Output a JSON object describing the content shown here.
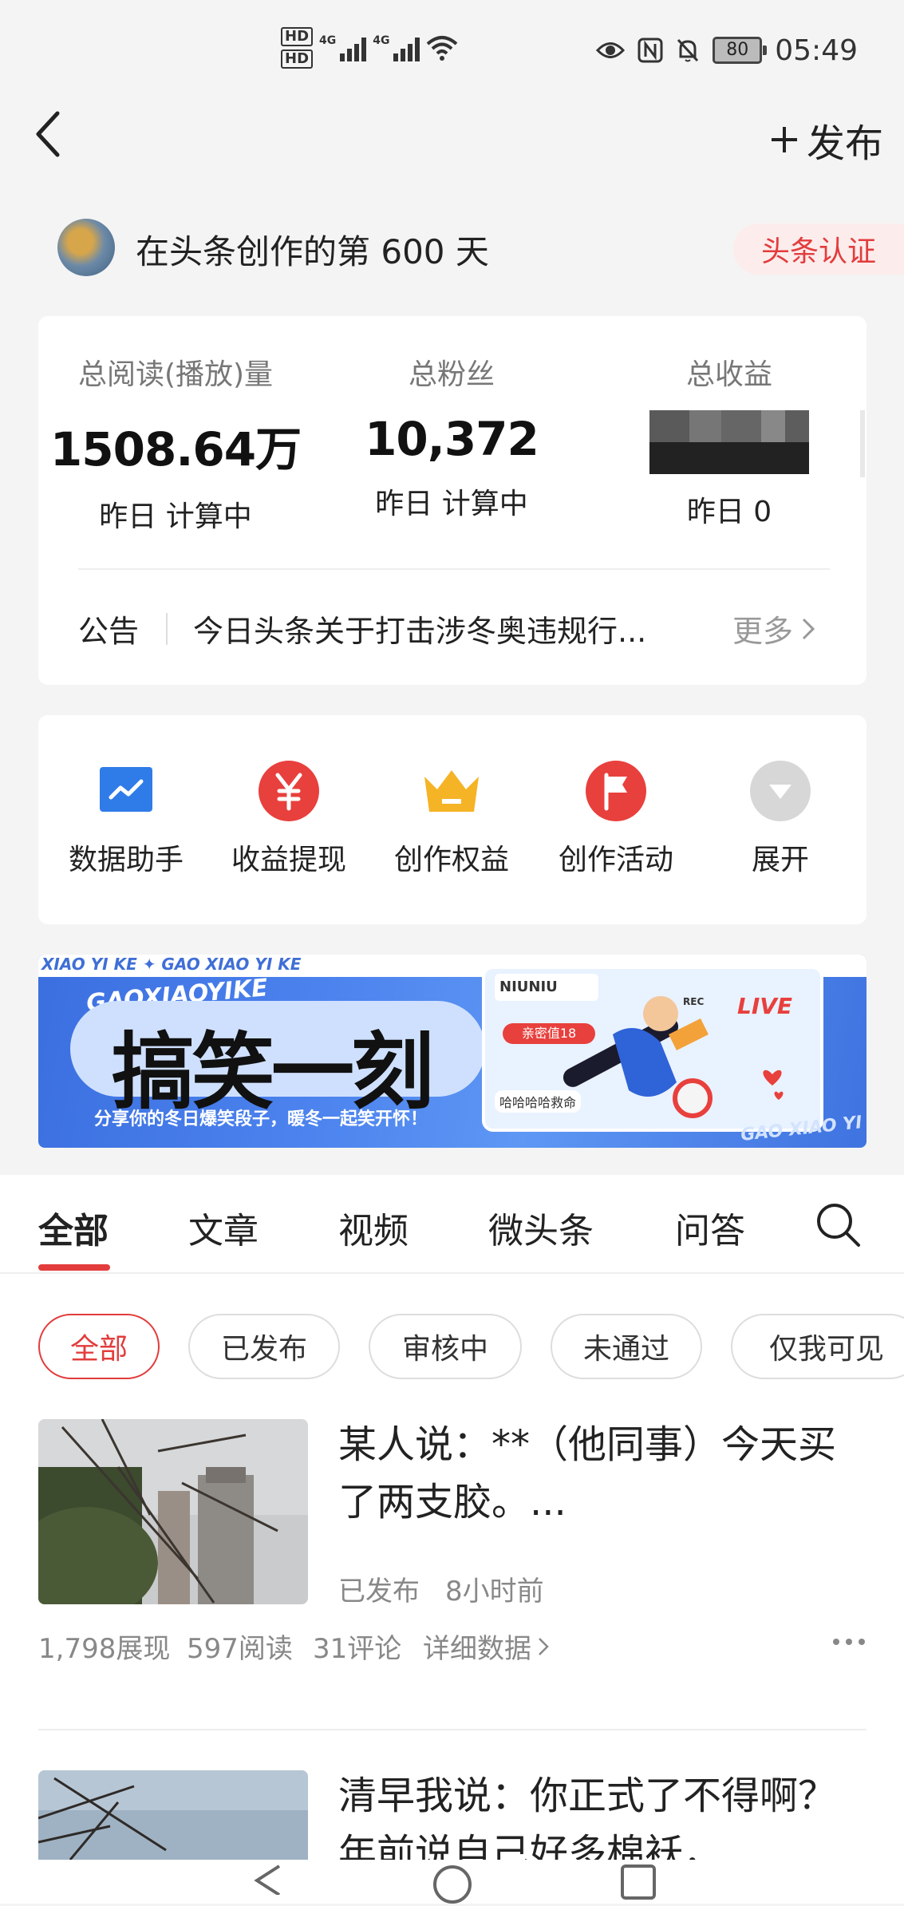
{
  "status_bar": {
    "hd1": "HD",
    "hd2": "HD",
    "net1": "4G",
    "net2": "4G",
    "battery": "80",
    "time": "05:49"
  },
  "header": {
    "publish_label": "发布"
  },
  "creator": {
    "days_text": "在头条创作的第 600 天",
    "cert_label": "头条认证"
  },
  "stats": {
    "reads": {
      "label": "总阅读(播放)量",
      "value": "1508.64万",
      "sub": "昨日 计算中"
    },
    "fans": {
      "label": "总粉丝",
      "value": "10,372",
      "sub": "昨日 计算中"
    },
    "income": {
      "label": "总收益",
      "sub": "昨日 0"
    }
  },
  "notice": {
    "label": "公告",
    "text": "今日头条关于打击涉冬奥违规行...",
    "more": "更多"
  },
  "tools": [
    {
      "label": "数据助手",
      "icon": "chart-icon",
      "color": "#2f7be8"
    },
    {
      "label": "收益提现",
      "icon": "yuan-icon",
      "color": "#e8403d"
    },
    {
      "label": "创作权益",
      "icon": "crown-icon",
      "color": "#f5b326"
    },
    {
      "label": "创作活动",
      "icon": "flag-icon",
      "color": "#e8403d"
    },
    {
      "label": "展开",
      "icon": "expand-icon",
      "color": "#d7d7d7"
    }
  ],
  "banner": {
    "top_strip": "XIAO YI KE  ✦  GAO XIAO YI KE",
    "brand_small": "GAOXIAOYIKE",
    "title": "搞笑一刻",
    "subtitle": "分享你的冬日爆笑段子，暖冬一起笑开怀！",
    "live": "LIVE",
    "niuniu": "NIUNIU",
    "rec": "REC",
    "intimacy": "亲密值18",
    "help": "哈哈哈哈救命",
    "corner": "GAO XIAO YI"
  },
  "tabs": [
    "全部",
    "文章",
    "视频",
    "微头条",
    "问答"
  ],
  "filters": [
    "全部",
    "已发布",
    "审核中",
    "未通过",
    "仅我可见"
  ],
  "posts": [
    {
      "title": "某人说：**（他同事）今天买了两支胶。...",
      "status": "已发布",
      "time": "8小时前",
      "impressions": "1,798展现",
      "reads": "597阅读",
      "comments": "31评论",
      "detail": "详细数据"
    },
    {
      "title": "清早我说：你正式了不得啊？年前说自己好多棉袄，"
    }
  ],
  "colors": {
    "accent": "#e23c3c"
  }
}
